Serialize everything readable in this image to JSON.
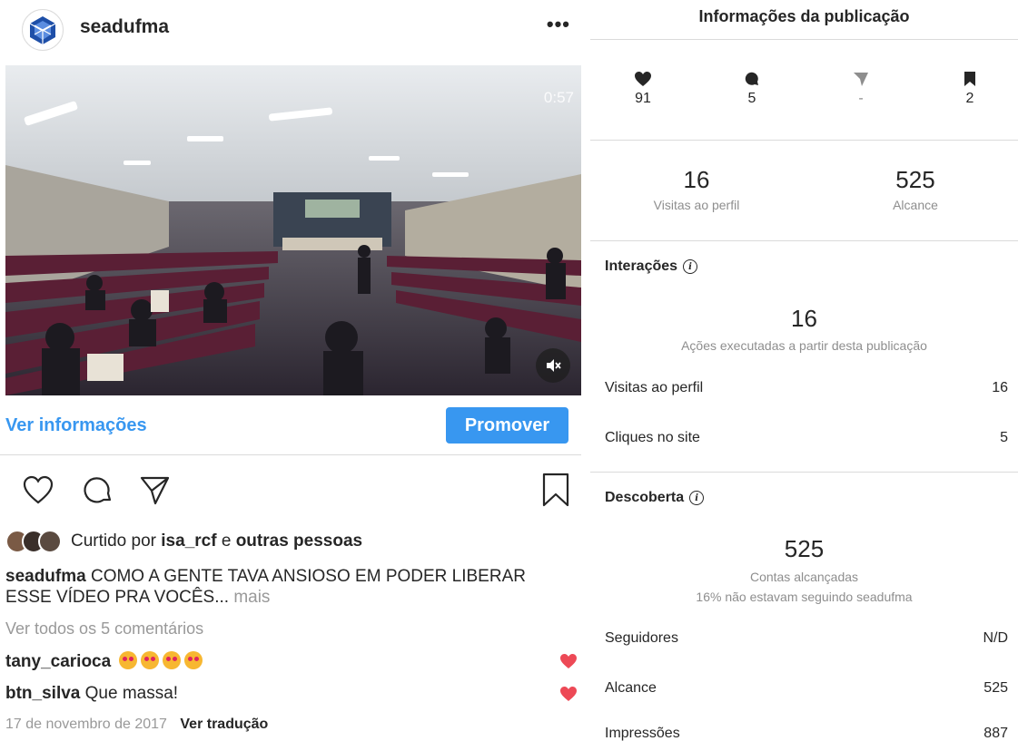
{
  "post": {
    "username": "seadufma",
    "more_label": "•••",
    "video_time": "0:57",
    "insights_link": "Ver informações",
    "promote_label": "Promover",
    "liked_by_prefix": "Curtido por",
    "liked_by_user": "isa_rcf",
    "liked_by_and": "e",
    "liked_by_others": "outras pessoas",
    "caption_user": "seadufma",
    "caption_text": "COMO A GENTE TAVA ANSIOSO EM PODER LIBERAR ESSE VÍDEO PRA VOCÊS...",
    "caption_more": "mais",
    "view_comments": "Ver todos os 5 comentários",
    "comments": [
      {
        "user": "tany_carioca",
        "text": ""
      },
      {
        "user": "btn_silva",
        "text": "Que massa!"
      }
    ],
    "date": "17 de novembro de 2017",
    "translate": "Ver tradução",
    "colors": {
      "accent": "#3897f0",
      "heart": "#ed4956"
    }
  },
  "insights": {
    "title": "Informações da publicação",
    "stats": {
      "likes": "91",
      "comments": "5",
      "shares": "-",
      "saves": "2"
    },
    "profile_visits": {
      "value": "16",
      "label": "Visitas ao perfil"
    },
    "reach": {
      "value": "525",
      "label": "Alcance"
    },
    "interactions": {
      "title": "Interações",
      "total": "16",
      "total_label": "Ações executadas a partir desta publicação",
      "rows": [
        {
          "label": "Visitas ao perfil",
          "value": "16"
        },
        {
          "label": "Cliques no site",
          "value": "5"
        }
      ]
    },
    "discovery": {
      "title": "Descoberta",
      "total": "525",
      "total_label": "Contas alcançadas",
      "sub_label": "16% não estavam seguindo seadufma",
      "rows": [
        {
          "label": "Seguidores",
          "value": "N/D"
        },
        {
          "label": "Alcance",
          "value": "525"
        },
        {
          "label": "Impressões",
          "value": "887"
        }
      ]
    }
  }
}
